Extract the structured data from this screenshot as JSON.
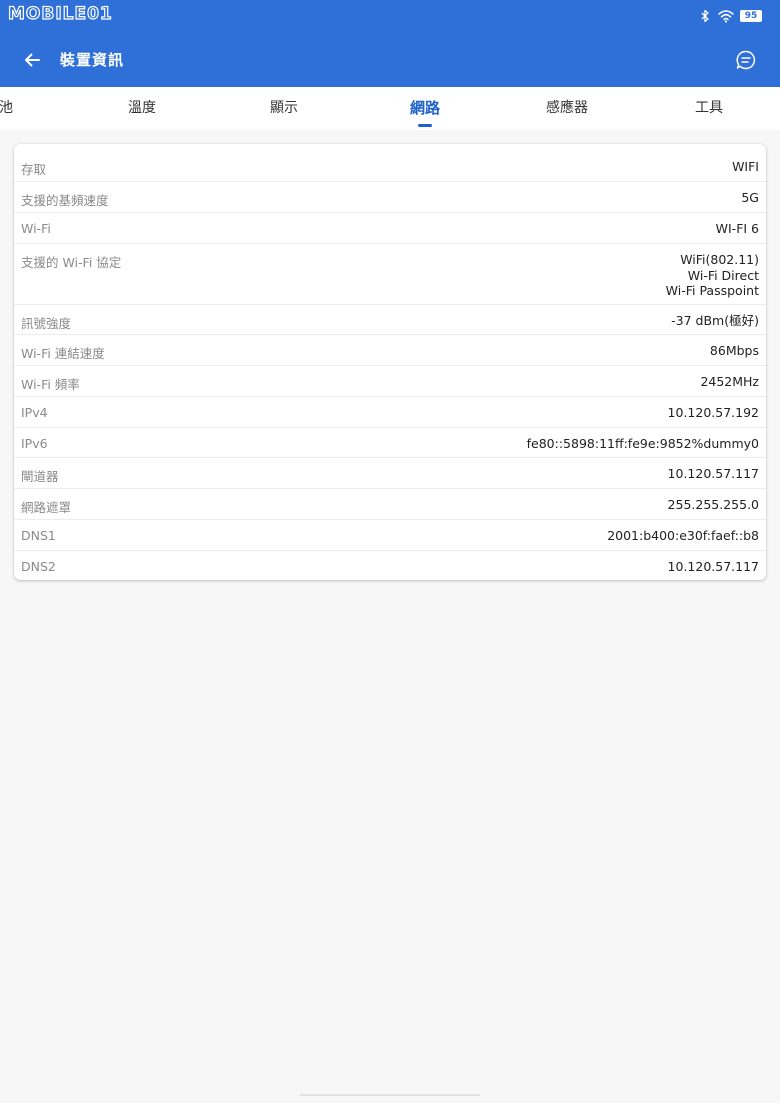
{
  "status_bar": {
    "watermark": "MOBILE01",
    "battery": "95",
    "icons": [
      "bluetooth-icon",
      "wifi-icon",
      "battery-icon"
    ]
  },
  "app_bar": {
    "title": "裝置資訊",
    "back_icon": "back-arrow-icon",
    "action_icon": "chat-bubble-icon"
  },
  "tabs": [
    {
      "label": "池",
      "active": false
    },
    {
      "label": "溫度",
      "active": false
    },
    {
      "label": "顯示",
      "active": false
    },
    {
      "label": "網路",
      "active": true
    },
    {
      "label": "感應器",
      "active": false
    },
    {
      "label": "工具",
      "active": false
    }
  ],
  "network_info": [
    {
      "label": "存取",
      "value": [
        "WIFI"
      ]
    },
    {
      "label": "支援的基頻速度",
      "value": [
        "5G"
      ]
    },
    {
      "label": "Wi-Fi",
      "value": [
        "WI-FI 6"
      ]
    },
    {
      "label": "支援的 Wi-Fi 協定",
      "value": [
        "WiFi(802.11)",
        "Wi-Fi Direct",
        "Wi-Fi Passpoint"
      ]
    },
    {
      "label": "訊號強度",
      "value": [
        "-37 dBm(極好)"
      ]
    },
    {
      "label": "Wi-Fi 連結速度",
      "value": [
        "86Mbps"
      ]
    },
    {
      "label": "Wi-Fi 頻率",
      "value": [
        "2452MHz"
      ]
    },
    {
      "label": "IPv4",
      "value": [
        "10.120.57.192"
      ]
    },
    {
      "label": "IPv6",
      "value": [
        "fe80::5898:11ff:fe9e:9852%dummy0"
      ]
    },
    {
      "label": "閘道器",
      "value": [
        "10.120.57.117"
      ]
    },
    {
      "label": "網路遮罩",
      "value": [
        "255.255.255.0"
      ]
    },
    {
      "label": "DNS1",
      "value": [
        "2001:b400:e30f:faef::b8"
      ]
    },
    {
      "label": "DNS2",
      "value": [
        "10.120.57.117"
      ]
    }
  ],
  "colors": {
    "primary": "#2e6fd8",
    "tab_active": "#1f62c9",
    "label_gray": "#8a8a8a",
    "background": "#f7f7f7"
  }
}
